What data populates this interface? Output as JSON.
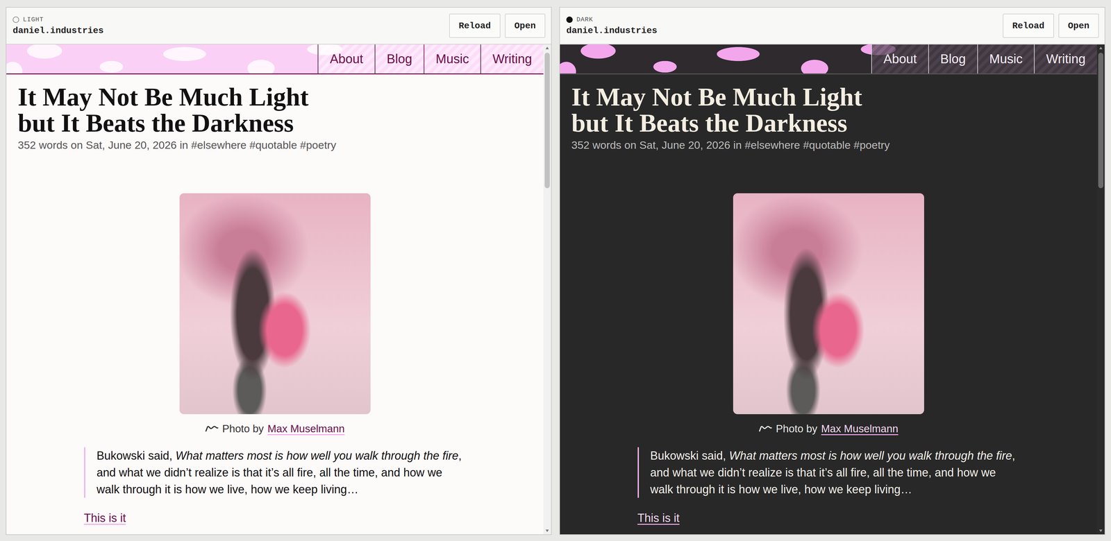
{
  "panes": [
    {
      "theme": "LIGHT",
      "dark": false,
      "site": "daniel.industries",
      "buttons": [
        "Reload",
        "Open"
      ],
      "nav": [
        {
          "label": "About"
        },
        {
          "label": "Blog"
        },
        {
          "label": "Music"
        },
        {
          "label": "Writing"
        }
      ],
      "post": {
        "title_lines": [
          "It May Not Be Much Light",
          "but It Beats the Darkness"
        ],
        "meta": "352 words on Sat, June 20, 2026 in #elsewhere #quotable #poetry",
        "caption": {
          "prefix": "Photo by",
          "credit": "Max Muselmann"
        },
        "quote": [
          {
            "text": "Bukowski said, ",
            "italic": false
          },
          {
            "text": "What matters most is how well you walk through the fire",
            "italic": true
          },
          {
            "text": ", and what we didn’t realize is that it’s all fire, all the time, and how we walk through it is how we live, how we keep living…",
            "italic": false
          }
        ],
        "link": "This is it"
      },
      "scrollbar": {
        "level": 0.29
      }
    },
    {
      "theme": "DARK",
      "dark": true,
      "site": "daniel.industries",
      "buttons": [
        "Reload",
        "Open"
      ],
      "nav": [
        {
          "label": "About"
        },
        {
          "label": "Blog"
        },
        {
          "label": "Music"
        },
        {
          "label": "Writing"
        }
      ],
      "post": {
        "title_lines": [
          "It May Not Be Much Light",
          "but It Beats the Darkness"
        ],
        "meta": "352 words on Sat, June 20, 2026 in #elsewhere #quotable #poetry",
        "caption": {
          "prefix": "Photo by",
          "credit": "Max Muselmann"
        },
        "quote": [
          {
            "text": "Bukowski said, ",
            "italic": false
          },
          {
            "text": "What matters most is how well you walk through the fire",
            "italic": true
          },
          {
            "text": ", and what we didn’t realize is that it’s all fire, all the time, and how we walk through it is how we live, how we keep living…",
            "italic": false
          }
        ],
        "link": "This is it"
      },
      "scrollbar": {
        "level": 0.29
      }
    }
  ]
}
